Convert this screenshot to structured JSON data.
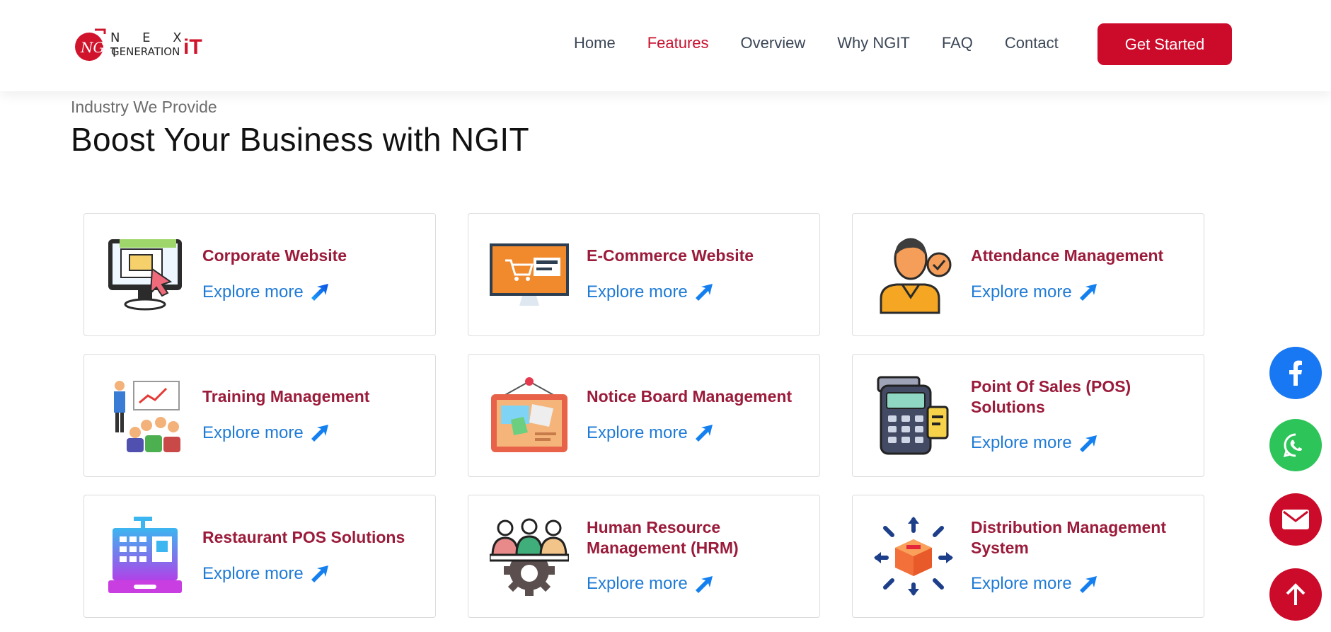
{
  "brand": {
    "name_top": "N E X T",
    "name_bottom": "GENERATION",
    "name_it": "iT",
    "accent": "#cc0a2a"
  },
  "nav": {
    "items": [
      {
        "label": "Home"
      },
      {
        "label": "Features"
      },
      {
        "label": "Overview"
      },
      {
        "label": "Why NGIT"
      },
      {
        "label": "FAQ"
      },
      {
        "label": "Contact"
      }
    ],
    "active": "Features",
    "cta_label": "Get Started"
  },
  "section": {
    "eyebrow": "Industry We Provide",
    "title": "Boost Your Business with NGIT"
  },
  "cards": [
    {
      "title": "Corporate Website",
      "link": "Explore more",
      "icon": "monitor-chart-icon"
    },
    {
      "title": "E-Commerce Website",
      "link": "Explore more",
      "icon": "shopping-monitor-icon"
    },
    {
      "title": "Attendance Management",
      "link": "Explore more",
      "icon": "person-check-icon"
    },
    {
      "title": "Training Management",
      "link": "Explore more",
      "icon": "presentation-audience-icon"
    },
    {
      "title": "Notice Board Management",
      "link": "Explore more",
      "icon": "notice-board-icon"
    },
    {
      "title": "Point Of Sales (POS) Solutions",
      "link": "Explore more",
      "icon": "pos-terminal-icon"
    },
    {
      "title": "Restaurant POS Solutions",
      "link": "Explore more",
      "icon": "cash-register-icon"
    },
    {
      "title": "Human Resource Management (HRM)",
      "link": "Explore more",
      "icon": "team-gear-icon"
    },
    {
      "title": "Distribution Management System",
      "link": "Explore more",
      "icon": "box-distribution-icon"
    }
  ],
  "floating": {
    "facebook": "facebook-icon",
    "whatsapp": "whatsapp-icon",
    "email": "mail-icon",
    "scroll_top": "arrow-up-icon"
  }
}
